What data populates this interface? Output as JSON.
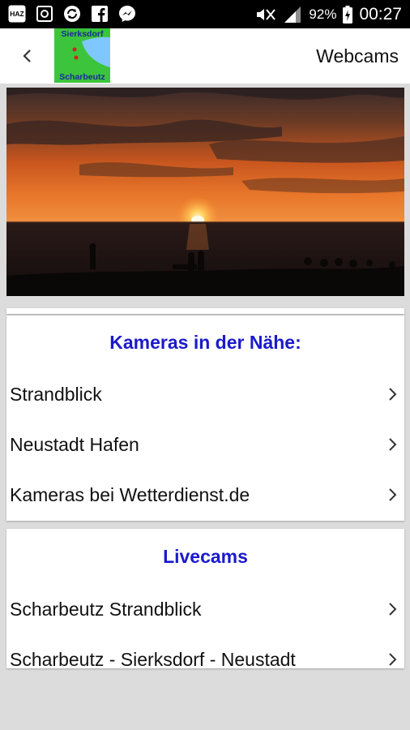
{
  "status_bar": {
    "battery": "92%",
    "time": "00:27",
    "icons": [
      "haz-icon",
      "screenshot-icon",
      "sync-icon",
      "facebook-icon",
      "messenger-icon",
      "mute-icon",
      "signal-icon",
      "battery-icon"
    ],
    "haz_label": "HAZ"
  },
  "app_bar": {
    "title": "Webcams",
    "logo_top": "Sierksdorf",
    "logo_bottom": "Scharbeutz",
    "back_icon": "chevron-left-icon"
  },
  "hero": {
    "description_icon": "sunset-image"
  },
  "section_nearby": {
    "header": "Kameras in der Nähe:",
    "items": [
      {
        "label": "Strandblick"
      },
      {
        "label": "Neustadt Hafen"
      },
      {
        "label": "Kameras bei Wetterdienst.de"
      }
    ]
  },
  "section_live": {
    "header": "Livecams",
    "items": [
      {
        "label": "Scharbeutz Strandblick"
      },
      {
        "label": "Scharbeutz - Sierksdorf - Neustadt"
      }
    ]
  },
  "colors": {
    "accent_header": "#1a1acc",
    "background": "#dcdcdc",
    "logo_green": "#3cc43c"
  }
}
